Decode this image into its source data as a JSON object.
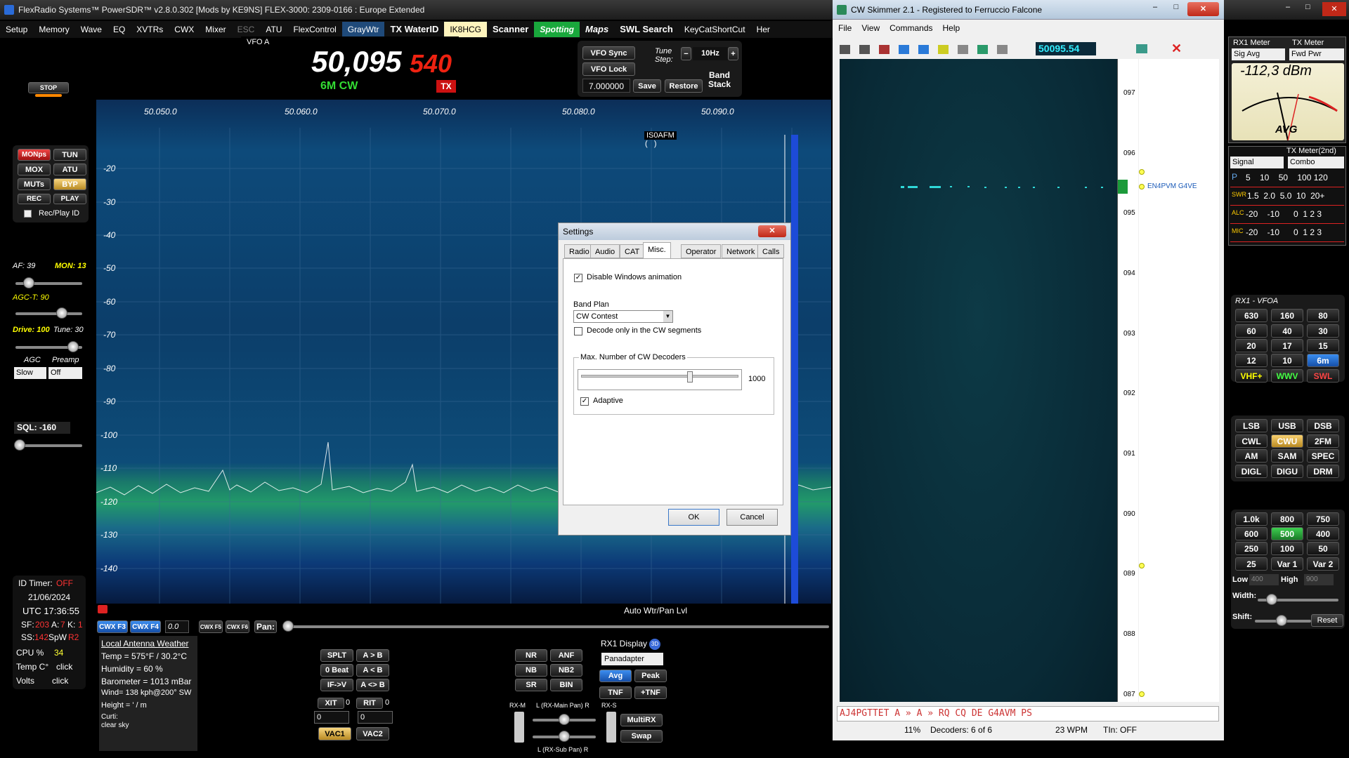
{
  "powersdr": {
    "title": "FlexRadio Systems™  PowerSDR™  v2.8.0.302   [Mods by KE9NS]   FLEX-3000: 2309-0166 : Europe Extended",
    "menu": [
      "Setup",
      "Memory",
      "Wave",
      "EQ",
      "XVTRs",
      "CWX",
      "Mixer",
      "ESC",
      "ATU",
      "FlexControl",
      "GrayWtr",
      "TX WaterID",
      "IK8HCG",
      "Scanner",
      "Spotting",
      "Maps",
      "SWL Search",
      "KeyCatShortCut",
      "Her"
    ],
    "vfo": {
      "label": "VFO A",
      "freq_main": "50,095",
      "freq_sub": "540",
      "mode": "6M CW",
      "tx": "TX"
    },
    "vfo_buttons": {
      "sync": "VFO Sync",
      "lock": "VFO Lock",
      "freq": "7.000000",
      "save": "Save",
      "restore": "Restore",
      "band_stack": "Band\nStack",
      "tune_step": "Tune\nStep:",
      "step": "10Hz"
    },
    "stop": "STOP",
    "left_buttons": [
      "MONps",
      "TUN",
      "MOX",
      "ATU",
      "MUTs",
      "BYP",
      "REC",
      "PLAY"
    ],
    "recplay": "Rec/Play ID",
    "af": "AF: 39",
    "mon": "MON: 13",
    "agct": "AGC-T: 90",
    "drive": "Drive: 100",
    "tune": "Tune: 30",
    "agc": "AGC",
    "preamp": "Preamp",
    "agc_val": "Slow",
    "preamp_val": "Off",
    "sql": "SQL: -160",
    "freq_scale": [
      "50.050.0",
      "50.060.0",
      "50.070.0",
      "50.080.0",
      "50.090.0"
    ],
    "db_scale": [
      "-20",
      "-30",
      "-40",
      "-50",
      "-60",
      "-70",
      "-80",
      "-90",
      "-100",
      "-110",
      "-120",
      "-130",
      "-140"
    ],
    "spot": "IS0AFM",
    "spot_paren": "(   )",
    "auto_wtr": "Auto Wtr/Pan Lvl",
    "cwx": [
      "CWX F3",
      "CWX F4",
      "0.0",
      "CWX F5",
      "CWX F6"
    ],
    "pan": "Pan:",
    "id_timer": "ID Timer:",
    "id_timer_val": "OFF",
    "date": "21/06/2024",
    "utc": "UTC  17:36:55",
    "sf": "SF:",
    "sf_val": "203",
    "a": "A:",
    "a_val": "7",
    "k": "K:",
    "k_val": "1",
    "ss": "SS:",
    "ss_val": "142",
    "spw": "SpW",
    "r2": "R2",
    "cpu": "CPU %",
    "cpu_val": "34",
    "temp": "Temp C°",
    "temp_val": "click",
    "volts": "Volts",
    "volts_val": "click",
    "weather": [
      "Local Antenna Weather",
      "Temp = 575°F / 30.2°C",
      "Humidity = 60 %",
      "Barometer = 1013 mBar",
      "Wind= 138 kph@200° SW",
      "Height = ' / m",
      "Curti:",
      "clear sky"
    ],
    "mid_buttons": [
      "SPLT",
      "A > B",
      "0 Beat",
      "A < B",
      "IF->V",
      "A <> B"
    ],
    "xit": "XIT",
    "xit_val": "0",
    "rit": "RIT",
    "rit_val": "0",
    "x0": "0",
    "r0": "0",
    "vac1": "VAC1",
    "vac2": "VAC2",
    "dsp": [
      "NR",
      "ANF",
      "NB",
      "NB2",
      "SR",
      "BIN"
    ],
    "rx1display": "RX1 Display",
    "display_mode": "Panadapter",
    "avg": "Avg",
    "peak": "Peak",
    "tnf": "TNF",
    "ptnf": "+TNF",
    "rxm": "RX-M",
    "rxs": "RX-S",
    "mainpan": "L (RX-Main Pan) R",
    "subpan": "L (RX-Sub Pan) R",
    "multirx": "MultiRX",
    "swap": "Swap",
    "meters": {
      "rx1": "RX1 Meter",
      "tx": "TX Meter",
      "rx1_sel": "Sig Avg",
      "tx_sel": "Fwd Pwr",
      "dbm": "-112,3 dBm",
      "avg": "AVG",
      "tx2": "TX Meter(2nd)",
      "sig": "Signal",
      "combo": "Combo",
      "p": "P",
      "p_scale": "5    10    50    100 120",
      "swr": "SWR",
      "swr_scale": "1.5  2.0  5.0  10  20+",
      "alc": "ALC",
      "alc_scale": "-20    -10      0  1 2 3",
      "mic": "MIC",
      "mic_scale": "-20    -10      0  1 2 3"
    },
    "rx1vfoa": "RX1 - VFOA",
    "bands": [
      "630",
      "160",
      "80",
      "60",
      "40",
      "30",
      "20",
      "17",
      "15",
      "12",
      "10",
      "6m",
      "VHF+",
      "WWV",
      "SWL"
    ],
    "modes": [
      "LSB",
      "USB",
      "DSB",
      "CWL",
      "CWU",
      "2FM",
      "AM",
      "SAM",
      "SPEC",
      "DIGL",
      "DIGU",
      "DRM"
    ],
    "filters": [
      "1.0k",
      "800",
      "750",
      "600",
      "500",
      "400",
      "250",
      "100",
      "50",
      "25",
      "Var 1",
      "Var 2"
    ],
    "low": "Low",
    "low_val": "400",
    "high": "High",
    "high_val": "900",
    "width": "Width:",
    "shift": "Shift:",
    "reset": "Reset"
  },
  "settings": {
    "title": "Settings",
    "tabs": [
      "Radio",
      "Audio",
      "CAT",
      "Misc.",
      "Operator",
      "Network",
      "Calls"
    ],
    "disable_anim": "Disable Windows animation",
    "band_plan": "Band Plan",
    "band_plan_val": "CW Contest",
    "decode_only": "Decode only in the CW segments",
    "max_decoders": "Max. Number of CW Decoders",
    "max_val": "1000",
    "adaptive": "Adaptive",
    "ok": "OK",
    "cancel": "Cancel"
  },
  "skimmer": {
    "title": "CW Skimmer 2.1 - Registered to Ferruccio Falcone",
    "menu": [
      "File",
      "View",
      "Commands",
      "Help"
    ],
    "freq": "50095.54",
    "scale": [
      "097",
      "096",
      "095",
      "094",
      "093",
      "092",
      "091",
      "090",
      "089",
      "088",
      "087"
    ],
    "spot": "EN4PVM G4VE",
    "decoded": "AJ4PGTTET A » A » RQ CQ DE G4AVM PS",
    "status": [
      "11%",
      "Decoders: 6 of 6",
      "23 WPM",
      "TIn: OFF"
    ]
  }
}
